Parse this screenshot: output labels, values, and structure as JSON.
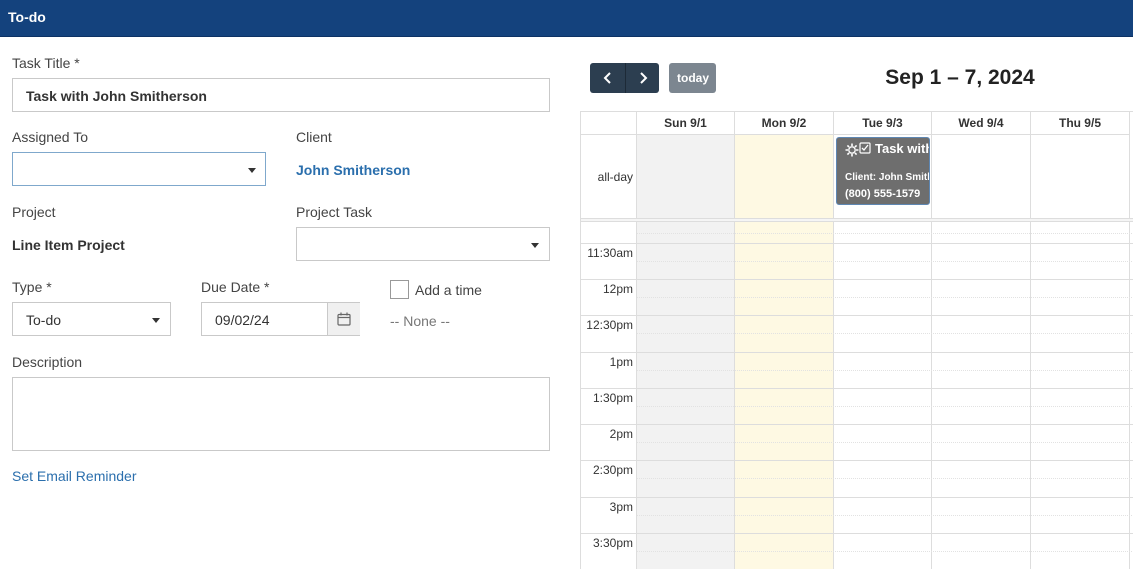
{
  "window": {
    "title": "To-do"
  },
  "form": {
    "task_title_label": "Task Title *",
    "task_title_value": "Task with John Smitherson",
    "assigned_to_label": "Assigned To",
    "assigned_to_value": "",
    "client_label": "Client",
    "client_value": "John Smitherson",
    "project_label": "Project",
    "project_value": "Line Item Project",
    "project_task_label": "Project Task",
    "project_task_value": "",
    "type_label": "Type *",
    "type_value": "To-do",
    "due_date_label": "Due Date *",
    "due_date_value": "09/02/24",
    "add_time_label": "Add a time",
    "time_value": "-- None --",
    "description_label": "Description",
    "description_value": "",
    "email_reminder_link": "Set Email Reminder"
  },
  "calendar": {
    "prev_icon": "chevron-left-icon",
    "next_icon": "chevron-right-icon",
    "today_label": "today",
    "title": "Sep 1 – 7, 2024",
    "days": [
      "Sun 9/1",
      "Mon 9/2",
      "Tue 9/3",
      "Wed 9/4",
      "Thu 9/5"
    ],
    "allday_label": "all-day",
    "time_labels": [
      "11:30am",
      "12pm",
      "12:30pm",
      "1pm",
      "1:30pm",
      "2pm",
      "2:30pm",
      "3pm",
      "3:30pm"
    ],
    "event": {
      "title": "Task with John Smitherson",
      "client_line": "Client: John Smitherson",
      "phone": "(800) 555-1579",
      "color": "#6e6e6e"
    },
    "colors": {
      "today_bg": "#fef9e3",
      "weekend_bg": "#f2f2f2",
      "header_bg": "#14427d",
      "link": "#2b6fad"
    }
  }
}
